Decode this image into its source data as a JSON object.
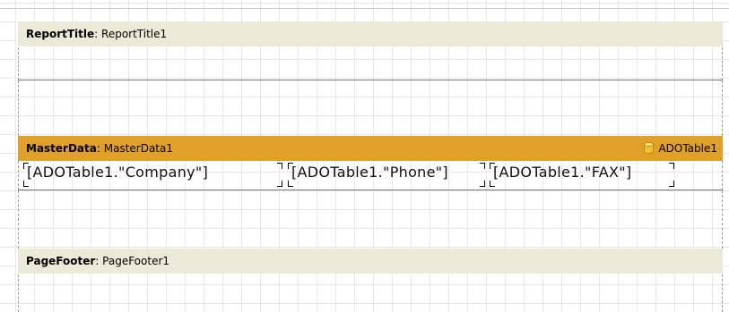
{
  "bands": {
    "report_title": {
      "type_label": "ReportTitle",
      "separator": ": ",
      "name": "ReportTitle1"
    },
    "master_data": {
      "type_label": "MasterData",
      "separator": ": ",
      "name": "MasterData1",
      "datasource": "ADOTable1",
      "fields": [
        "[ADOTable1.\"Company\"]",
        "[ADOTable1.\"Phone\"]",
        "[ADOTable1.\"FAX\"]"
      ]
    },
    "page_footer": {
      "type_label": "PageFooter",
      "separator": ": ",
      "name": "PageFooter1"
    }
  },
  "colors": {
    "band_header_light": "#ece9d8",
    "band_header_master": "#e0a02a",
    "grid": "#e8e8e8"
  },
  "icons": {
    "datasource": "database-cylinder-icon"
  }
}
